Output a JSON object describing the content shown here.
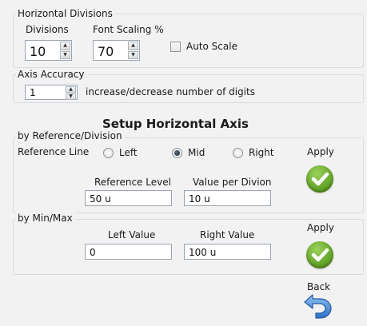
{
  "horizontal_divisions": {
    "group_title": "Horizontal Divisions",
    "divisions_label": "Divisions",
    "divisions_value": "10",
    "font_scaling_label": "Font Scaling %",
    "font_scaling_value": "70",
    "auto_scale_label": "Auto Scale",
    "auto_scale_checked": false
  },
  "axis_accuracy": {
    "group_title": "Axis Accuracy",
    "value": "1",
    "hint": "increase/decrease number of digits"
  },
  "heading": "Setup Horizontal Axis",
  "by_reference": {
    "group_title": "by Reference/Division",
    "reference_line_label": "Reference Line",
    "options": [
      "Left",
      "Mid",
      "Right"
    ],
    "selected": "Mid",
    "apply_label": "Apply",
    "reference_level_label": "Reference Level",
    "reference_level_value": "50  u",
    "value_per_division_label": "Value per Divion",
    "value_per_division_value": "10  u"
  },
  "by_minmax": {
    "group_title": "by Min/Max",
    "apply_label": "Apply",
    "left_value_label": "Left Value",
    "left_value": "0",
    "right_value_label": "Right Value",
    "right_value": "100 u"
  },
  "back_label": "Back",
  "colors": {
    "apply_green": "#5c9e22",
    "back_blue": "#3d7fd6",
    "background": "#f2f2f2"
  }
}
